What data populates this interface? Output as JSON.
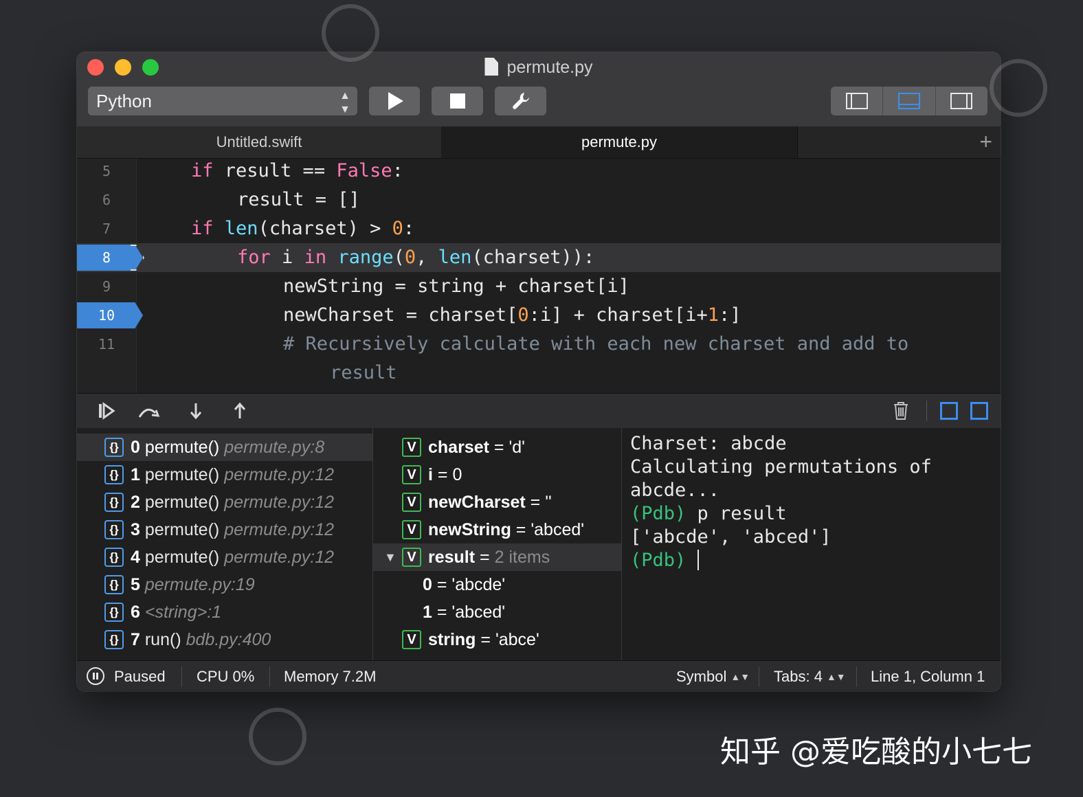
{
  "window": {
    "title": "permute.py",
    "language": "Python"
  },
  "tabs": [
    {
      "label": "Untitled.swift",
      "active": false
    },
    {
      "label": "permute.py",
      "active": true
    }
  ],
  "editor": {
    "lines": [
      {
        "num": "5"
      },
      {
        "num": "6"
      },
      {
        "num": "7"
      },
      {
        "num": "8"
      },
      {
        "num": "9"
      },
      {
        "num": "10"
      },
      {
        "num": "11"
      }
    ],
    "code": {
      "l5_if": "if",
      "l5_rest": " result == ",
      "l5_false": "False",
      "l5_colon": ":",
      "l6": "result = []",
      "l7_if": "if",
      "l7_len": "len",
      "l7_rest": "(charset) > ",
      "l7_num": "0",
      "l7_colon": ":",
      "l8_for": "for",
      "l8_i": " i ",
      "l8_in": "in",
      "l8_range": "range",
      "l8_open": "(",
      "l8_zero": "0",
      "l8_comma": ", ",
      "l8_len": "len",
      "l8_rest": "(charset)):",
      "l9": "newString = string + charset[i]",
      "l10_a": "newCharset = charset[",
      "l10_zero": "0",
      "l10_b": ":i] + charset[i+",
      "l10_one": "1",
      "l10_c": ":]",
      "l11": "# Recursively calculate with each new charset and add to",
      "l11_wrap": "result"
    },
    "current_line": "8",
    "breakpoints": [
      "8",
      "10"
    ]
  },
  "stack": [
    {
      "idx": "0",
      "name": "permute()",
      "loc": "permute.py:8"
    },
    {
      "idx": "1",
      "name": "permute()",
      "loc": "permute.py:12"
    },
    {
      "idx": "2",
      "name": "permute()",
      "loc": "permute.py:12"
    },
    {
      "idx": "3",
      "name": "permute()",
      "loc": "permute.py:12"
    },
    {
      "idx": "4",
      "name": "permute()",
      "loc": "permute.py:12"
    },
    {
      "idx": "5",
      "name": "",
      "loc": "permute.py:19"
    },
    {
      "idx": "6",
      "name": "",
      "loc": "<string>:1"
    },
    {
      "idx": "7",
      "name": "run()",
      "loc": "bdb.py:400"
    }
  ],
  "frame_icon": "{}",
  "variables": [
    {
      "name": "charset",
      "value": "'d'"
    },
    {
      "name": "i",
      "value": "0"
    },
    {
      "name": "newCharset",
      "value": "''"
    },
    {
      "name": "newString",
      "value": "'abced'"
    },
    {
      "name": "result",
      "value": "2 items"
    },
    {
      "child_key": "0",
      "value": "'abcde'"
    },
    {
      "child_key": "1",
      "value": "'abced'"
    },
    {
      "name": "string",
      "value": "'abce'"
    }
  ],
  "var_icon": "V",
  "var_eq": "=",
  "console": {
    "l1": "Charset: abcde",
    "l2": "Calculating permutations of",
    "l3": "abcde...",
    "l4_prompt": "(Pdb)",
    "l4_cmd": " p result",
    "l5": "['abcde', 'abced']",
    "l6_prompt": "(Pdb)"
  },
  "status": {
    "state": "Paused",
    "cpu": "CPU 0%",
    "memory": "Memory 7.2M",
    "symbol": "Symbol",
    "tabs": "Tabs: 4",
    "position": "Line 1, Column 1"
  },
  "icons": {
    "updown": "⌃⌄",
    "add_tab": "+",
    "continue": "▶",
    "step_over": "⤳",
    "step_into": "↓",
    "step_out": "↑",
    "trash": "🗑"
  },
  "watermark": "知乎 @爱吃酸的小七七",
  "colors": {
    "keyword": "#ff7ab2",
    "function": "#6bdfff",
    "number": "#ffa14f",
    "comment": "#7f8c98",
    "breakpoint": "#3f86d6",
    "pdb_prompt": "#38c27a",
    "accent": "#3b8ef0"
  }
}
